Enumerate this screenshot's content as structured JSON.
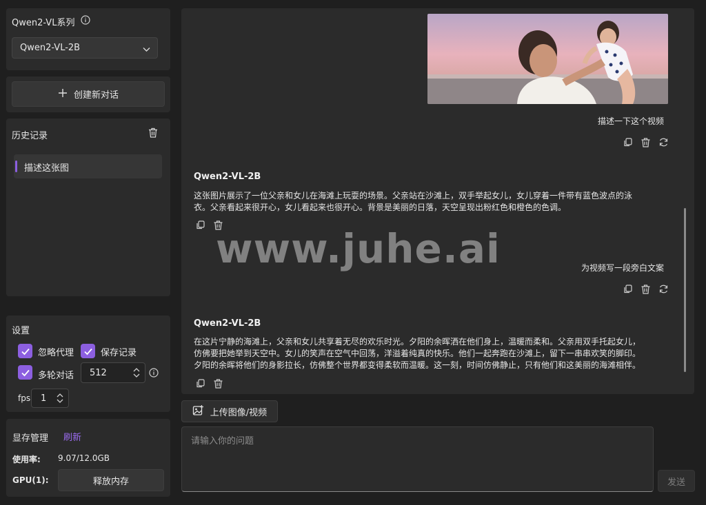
{
  "model_section": {
    "label": "Qwen2-VL系列",
    "selected_model": "Qwen2-VL-2B"
  },
  "new_chat_label": "创建新对话",
  "history": {
    "title": "历史记录",
    "items": [
      {
        "label": "描述这张图"
      }
    ]
  },
  "settings": {
    "title": "设置",
    "ignore_proxy_label": "忽略代理",
    "save_history_label": "保存记录",
    "multi_turn_label": "多轮对话",
    "max_tokens_value": "512",
    "fps_label": "fps",
    "fps_value": "1"
  },
  "memory": {
    "title": "显存管理",
    "refresh_label": "刷新",
    "usage_label": "使用率:",
    "usage_value": "9.07/12.0GB",
    "gpu_label": "GPU(1):",
    "release_label": "释放内存"
  },
  "chat": {
    "messages": [
      {
        "role": "user",
        "text": "描述一下这个视频"
      },
      {
        "role": "assistant",
        "name": "Qwen2-VL-2B",
        "text": "这张图片展示了一位父亲和女儿在海滩上玩耍的场景。父亲站在沙滩上，双手举起女儿，女儿穿着一件带有蓝色波点的泳衣。父亲看起来很开心，女儿看起来也很开心。背景是美丽的日落，天空呈现出粉红色和橙色的色调。"
      },
      {
        "role": "user",
        "text": "为视频写一段旁白文案"
      },
      {
        "role": "assistant",
        "name": "Qwen2-VL-2B",
        "text": "在这片宁静的海滩上，父亲和女儿共享着无尽的欢乐时光。夕阳的余晖洒在他们身上，温暖而柔和。父亲用双手托起女儿，仿佛要把她举到天空中。女儿的笑声在空气中回荡，洋溢着纯真的快乐。他们一起奔跑在沙滩上，留下一串串欢笑的脚印。夕阳的余晖将他们的身影拉长，仿佛整个世界都变得柔软而温暖。这一刻，时间仿佛静止，只有他们和这美丽的海滩相伴。"
      }
    ]
  },
  "watermark": "www.juhe.ai",
  "upload_label": "上传图像/视频",
  "input": {
    "placeholder": "请输入你的问题",
    "send_label": "发送"
  },
  "colors": {
    "accent": "#8c5fe0",
    "panel_bg": "#2b2b2b",
    "page_bg": "#1f1f1f"
  }
}
